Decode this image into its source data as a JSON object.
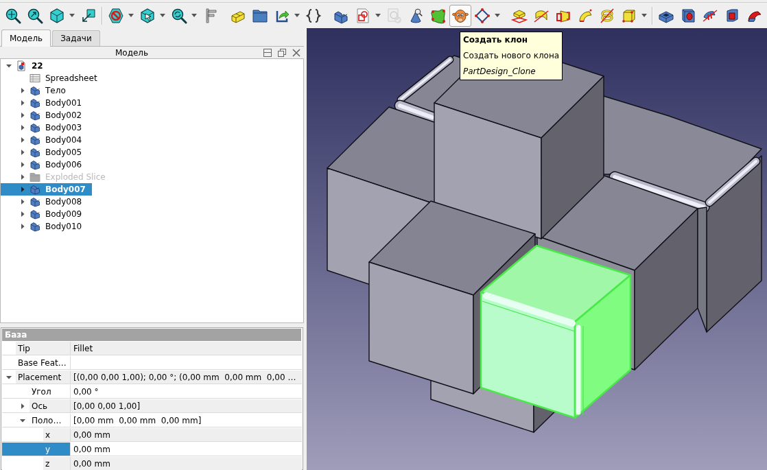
{
  "toolbar": {
    "groups": [
      {
        "divider": false,
        "buttons": [
          {
            "menu": false,
            "hovered": false,
            "disabled": false
          },
          {
            "menu": false,
            "hovered": false,
            "disabled": false
          },
          {
            "menu": true,
            "hovered": false,
            "disabled": false
          },
          {
            "menu": false,
            "hovered": false,
            "disabled": false
          }
        ]
      },
      {
        "divider": true,
        "buttons": [
          {
            "menu": true,
            "hovered": false,
            "disabled": false
          },
          {
            "menu": true,
            "hovered": false,
            "disabled": false
          },
          {
            "menu": true,
            "hovered": false,
            "disabled": false
          },
          {
            "menu": false,
            "hovered": false,
            "disabled": false
          }
        ]
      },
      {
        "divider": false,
        "buttons": [
          {
            "menu": false,
            "hovered": false,
            "disabled": false
          },
          {
            "menu": false,
            "hovered": false,
            "disabled": false
          },
          {
            "menu": true,
            "hovered": false,
            "disabled": false
          },
          {
            "menu": false,
            "hovered": false,
            "disabled": false
          }
        ]
      },
      {
        "divider": false,
        "buttons": [
          {
            "menu": false,
            "hovered": false,
            "disabled": false
          },
          {
            "menu": true,
            "hovered": false,
            "disabled": false
          },
          {
            "menu": false,
            "hovered": false,
            "disabled": true
          },
          {
            "menu": false,
            "hovered": false,
            "disabled": false
          },
          {
            "menu": false,
            "hovered": false,
            "disabled": false
          },
          {
            "menu": false,
            "hovered": true,
            "disabled": false
          },
          {
            "menu": true,
            "hovered": false,
            "disabled": false
          }
        ]
      },
      {
        "divider": false,
        "buttons": [
          {
            "menu": false,
            "hovered": false,
            "disabled": false
          },
          {
            "menu": false,
            "hovered": false,
            "disabled": false
          },
          {
            "menu": false,
            "hovered": false,
            "disabled": false
          },
          {
            "menu": false,
            "hovered": false,
            "disabled": false
          },
          {
            "menu": false,
            "hovered": false,
            "disabled": false
          },
          {
            "menu": true,
            "hovered": false,
            "disabled": false
          }
        ]
      },
      {
        "divider": true,
        "buttons": [
          {
            "menu": false,
            "hovered": false,
            "disabled": false
          },
          {
            "menu": false,
            "hovered": false,
            "disabled": false
          },
          {
            "menu": false,
            "hovered": false,
            "disabled": false
          },
          {
            "menu": false,
            "hovered": false,
            "disabled": false
          },
          {
            "menu": false,
            "hovered": false,
            "disabled": false
          }
        ]
      }
    ]
  },
  "tabs": [
    {
      "label": "Модель",
      "selected": true
    },
    {
      "label": "Задачи",
      "selected": false
    }
  ],
  "tree": {
    "title": "Модель",
    "items": [
      {
        "label": "22",
        "kind": "document",
        "expanded": true,
        "selected": false,
        "active": true,
        "hidden": false,
        "children": [
          {
            "label": "Spreadsheet",
            "kind": "spreadsheet",
            "selected": false,
            "active": false,
            "hidden": false
          },
          {
            "label": "Тело",
            "kind": "body",
            "expanded": false,
            "selected": false,
            "active": false,
            "hidden": false
          },
          {
            "label": "Body001",
            "kind": "body",
            "expanded": false,
            "selected": false,
            "active": false,
            "hidden": false
          },
          {
            "label": "Body002",
            "kind": "body",
            "expanded": false,
            "selected": false,
            "active": false,
            "hidden": false
          },
          {
            "label": "Body003",
            "kind": "body",
            "expanded": false,
            "selected": false,
            "active": false,
            "hidden": false
          },
          {
            "label": "Body004",
            "kind": "body",
            "expanded": false,
            "selected": false,
            "active": false,
            "hidden": false
          },
          {
            "label": "Body005",
            "kind": "body",
            "expanded": false,
            "selected": false,
            "active": false,
            "hidden": false
          },
          {
            "label": "Body006",
            "kind": "body",
            "expanded": false,
            "selected": false,
            "active": false,
            "hidden": false
          },
          {
            "label": "Exploded Slice",
            "kind": "folder",
            "expanded": false,
            "selected": false,
            "active": false,
            "hidden": true
          },
          {
            "label": "Body007",
            "kind": "body",
            "expanded": false,
            "selected": true,
            "active": true,
            "hidden": false
          },
          {
            "label": "Body008",
            "kind": "body",
            "expanded": false,
            "selected": false,
            "active": false,
            "hidden": false
          },
          {
            "label": "Body009",
            "kind": "body",
            "expanded": false,
            "selected": false,
            "active": false,
            "hidden": false
          },
          {
            "label": "Body010",
            "kind": "body",
            "expanded": false,
            "selected": false,
            "active": false,
            "hidden": false
          }
        ]
      }
    ]
  },
  "properties": {
    "group": "База",
    "rows": [
      {
        "name": "Tip",
        "value": "Fillet",
        "selected": false
      },
      {
        "name": "Base Feat…",
        "selected": false
      },
      {
        "name": "Placement",
        "value": "[(0,00 0,00 1,00); 0,00 °; (0,00 mm  0,00 mm  0,00 …",
        "expanded": true,
        "selected": false,
        "children": [
          {
            "name": "Угол",
            "value": "0,00 °",
            "selected": false
          },
          {
            "name": "Ось",
            "value": "[0,00 0,00 1,00]",
            "expanded": false,
            "selected": false
          },
          {
            "name": "Поло…",
            "value": "[0,00 mm  0,00 mm  0,00 mm]",
            "expanded": true,
            "selected": false,
            "children": [
              {
                "name": "x",
                "value": "0,00 mm",
                "selected": false
              },
              {
                "name": "y",
                "value": "0,00 mm",
                "selected": true
              },
              {
                "name": "z",
                "value": "0,00 mm",
                "selected": false
              }
            ]
          }
        ]
      }
    ]
  },
  "tooltip": {
    "title": "Создать клон",
    "text": "Создать нового клона",
    "command": "PartDesign_Clone"
  }
}
